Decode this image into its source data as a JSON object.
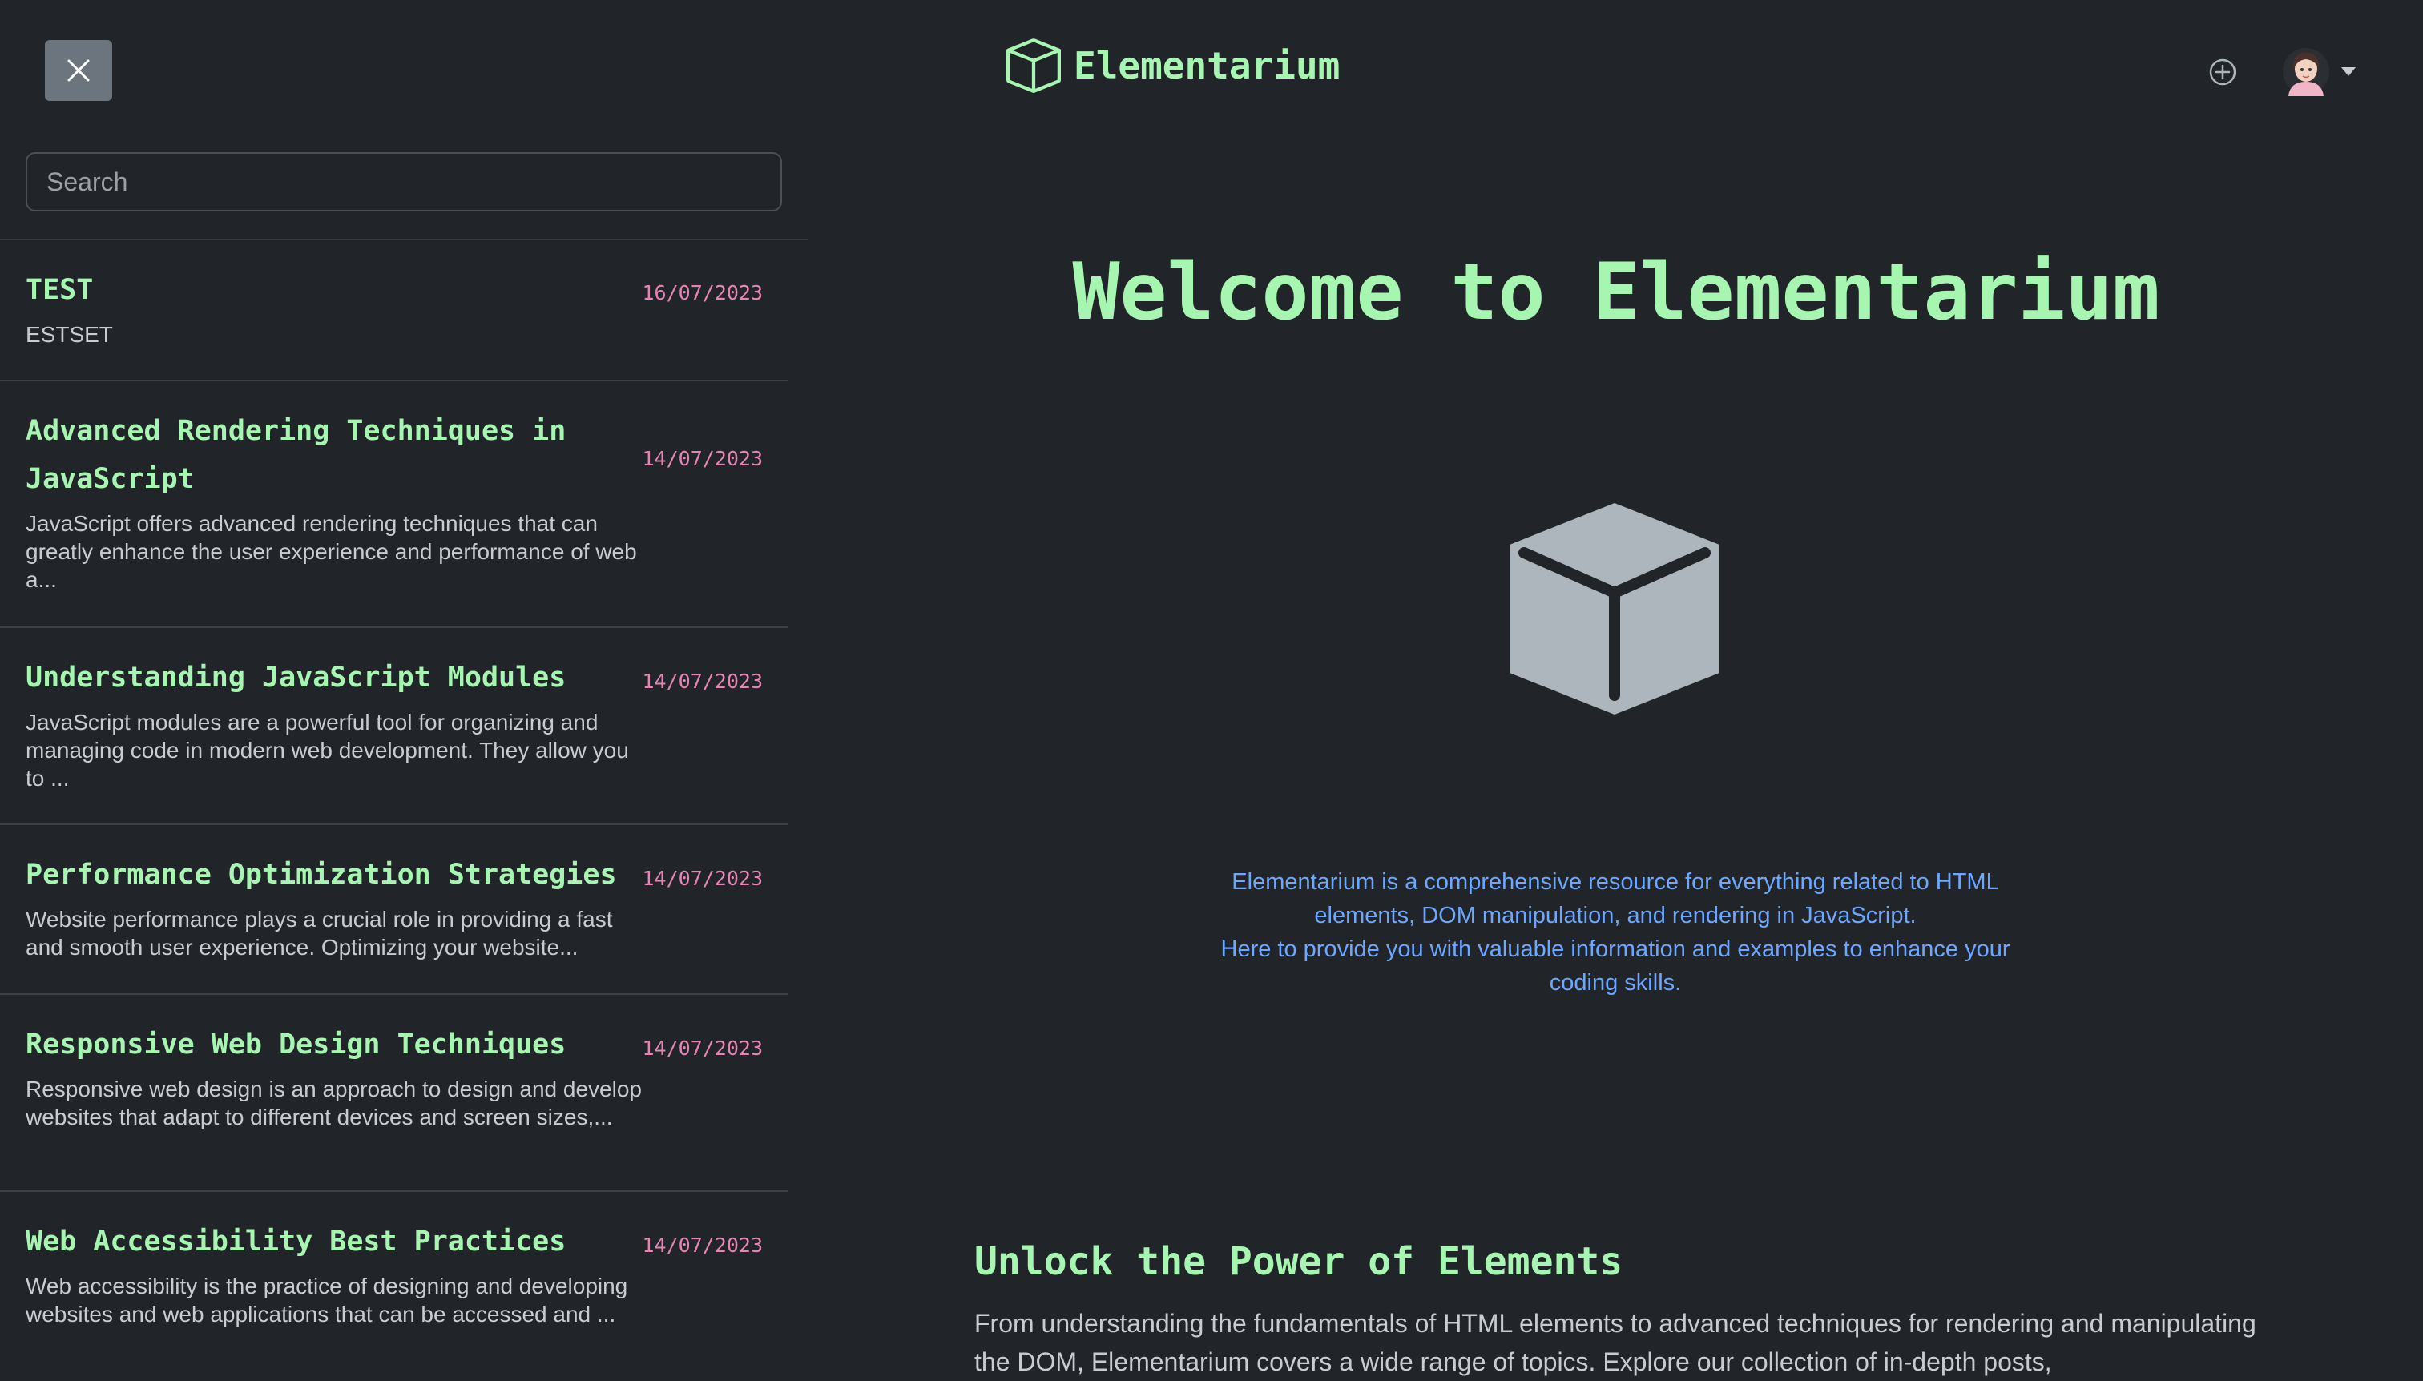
{
  "header": {
    "brand_name": "Elementarium",
    "close_icon": "close-icon",
    "add_icon": "plus-circle-icon",
    "avatar": "user-avatar",
    "accent_color": "#a6f5b0"
  },
  "sidebar": {
    "search_placeholder": "Search",
    "posts": [
      {
        "title": "TEST",
        "date": "16/07/2023",
        "excerpt": "ESTSET"
      },
      {
        "title": "Advanced Rendering Techniques in JavaScript",
        "date": "14/07/2023",
        "excerpt": "JavaScript offers advanced rendering techniques that can greatly enhance the user experience and performance of web a..."
      },
      {
        "title": "Understanding JavaScript Modules",
        "date": "14/07/2023",
        "excerpt": "JavaScript modules are a powerful tool for organizing and managing code in modern web development. They allow you to ..."
      },
      {
        "title": "Performance Optimization Strategies",
        "date": "14/07/2023",
        "excerpt": "Website performance plays a crucial role in providing a fast and smooth user experience. Optimizing your website..."
      },
      {
        "title": "Responsive Web Design Techniques",
        "date": "14/07/2023",
        "excerpt": "Responsive web design is an approach to design and develop websites that adapt to different devices and screen sizes,..."
      },
      {
        "title": "Web Accessibility Best Practices",
        "date": "14/07/2023",
        "excerpt": "Web accessibility is the practice of designing and developing websites and web applications that can be accessed and ..."
      }
    ]
  },
  "main": {
    "hero_title": "Welcome to Elementarium",
    "intro_line1": "Elementarium is a comprehensive resource for everything related to HTML elements, DOM manipulation, and rendering in JavaScript.",
    "intro_line2": "Here to provide you with valuable information and examples to enhance your coding skills.",
    "section_title": "Unlock the Power of Elements",
    "section_body": "From understanding the fundamentals of HTML elements to advanced techniques for rendering and manipulating the DOM, Elementarium covers a wide range of topics. Explore our collection of in-depth posts,"
  }
}
